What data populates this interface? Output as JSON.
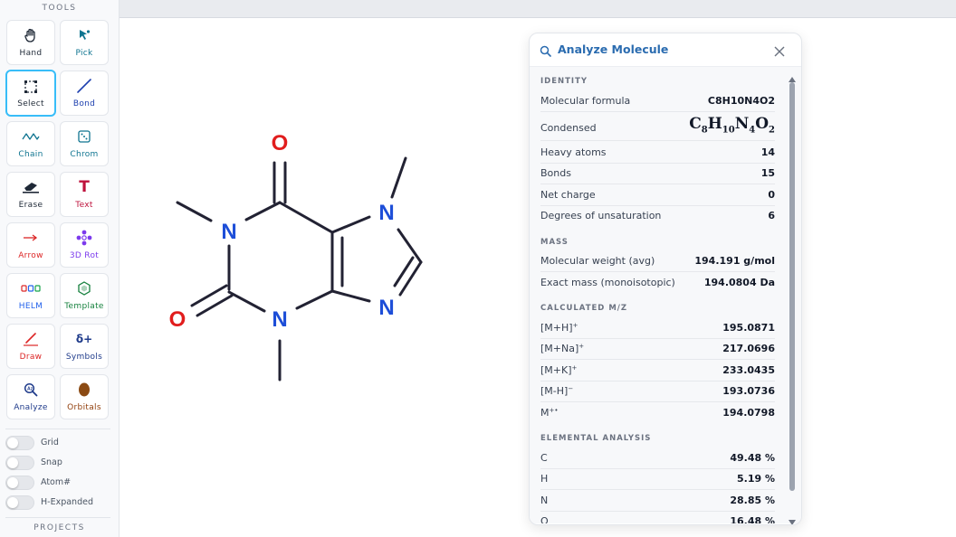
{
  "sidebar": {
    "tools_title": "TOOLS",
    "projects_title": "PROJECTS",
    "tools": [
      {
        "label": "Hand",
        "icon": "hand-icon",
        "color": "#1f2937"
      },
      {
        "label": "Pick",
        "icon": "pointer-icon",
        "color": "#0e7490"
      },
      {
        "label": "Select",
        "icon": "marquee-select-icon",
        "color": "#1f2937",
        "active": true
      },
      {
        "label": "Bond",
        "icon": "bond-line-icon",
        "color": "#1e40af"
      },
      {
        "label": "Chain",
        "icon": "zigzag-chain-icon",
        "color": "#0e7490"
      },
      {
        "label": "Chrom",
        "icon": "dice-icon",
        "color": "#0e7490"
      },
      {
        "label": "Erase",
        "icon": "eraser-icon",
        "color": "#1f2937"
      },
      {
        "label": "Text",
        "icon": "text-t-icon",
        "color": "#be123c"
      },
      {
        "label": "Arrow",
        "icon": "arrow-right-icon",
        "color": "#dc2626"
      },
      {
        "label": "3D Rot",
        "icon": "rotate-3d-icon",
        "color": "#7c3aed"
      },
      {
        "label": "HELM",
        "icon": "helm-monomer-icon",
        "color": "#2563eb"
      },
      {
        "label": "Template",
        "icon": "hexagon-template-icon",
        "color": "#15803d"
      },
      {
        "label": "Draw",
        "icon": "pencil-icon",
        "color": "#dc2626"
      },
      {
        "label": "Symbols",
        "icon": "delta-plus-icon",
        "color": "#1e3a8a"
      },
      {
        "label": "Analyze",
        "icon": "magnifier-analyze-icon",
        "color": "#1e3a8a"
      },
      {
        "label": "Orbitals",
        "icon": "orbital-lobe-icon",
        "color": "#92400e"
      }
    ],
    "toggles": [
      {
        "label": "Grid",
        "on": false
      },
      {
        "label": "Snap",
        "on": false
      },
      {
        "label": "Atom#",
        "on": false
      },
      {
        "label": "H-Expanded",
        "on": false
      }
    ]
  },
  "molecule": {
    "atom_labels": {
      "O1": "O",
      "O2": "O",
      "N1": "N",
      "N3": "N",
      "N7": "N",
      "N9": "N"
    },
    "oxygen_color": "#e11d1d",
    "nitrogen_color": "#1d4ed8",
    "bond_color": "#222233"
  },
  "panel": {
    "title": "Analyze Molecule",
    "accent": "#2b6cb0",
    "sections": {
      "identity": "IDENTITY",
      "mass": "MASS",
      "mz": "CALCULATED M/Z",
      "elemental": "ELEMENTAL ANALYSIS"
    },
    "identity": {
      "formula_label": "Molecular formula",
      "formula_value": "C8H10N4O2",
      "condensed_label": "Condensed",
      "condensed_parts": [
        "C",
        "8",
        "H",
        "10",
        "N",
        "4",
        "O",
        "2"
      ],
      "heavy_label": "Heavy atoms",
      "heavy_value": "14",
      "bonds_label": "Bonds",
      "bonds_value": "15",
      "charge_label": "Net charge",
      "charge_value": "0",
      "dou_label": "Degrees of unsaturation",
      "dou_value": "6"
    },
    "mass": {
      "mw_label": "Molecular weight (avg)",
      "mw_value": "194.191 g/mol",
      "exact_label": "Exact mass (monoisotopic)",
      "exact_value": "194.0804 Da"
    },
    "mz": [
      {
        "ion": "[M+H]",
        "charge": "+",
        "value": "195.0871"
      },
      {
        "ion": "[M+Na]",
        "charge": "+",
        "value": "217.0696"
      },
      {
        "ion": "[M+K]",
        "charge": "+",
        "value": "233.0435"
      },
      {
        "ion": "[M-H]",
        "charge": "−",
        "value": "193.0736"
      },
      {
        "ion": "M",
        "charge": "+•",
        "value": "194.0798"
      }
    ],
    "elemental": [
      {
        "el": "C",
        "value": "49.48 %"
      },
      {
        "el": "H",
        "value": "5.19 %"
      },
      {
        "el": "N",
        "value": "28.85 %"
      },
      {
        "el": "O",
        "value": "16.48 %"
      }
    ]
  }
}
